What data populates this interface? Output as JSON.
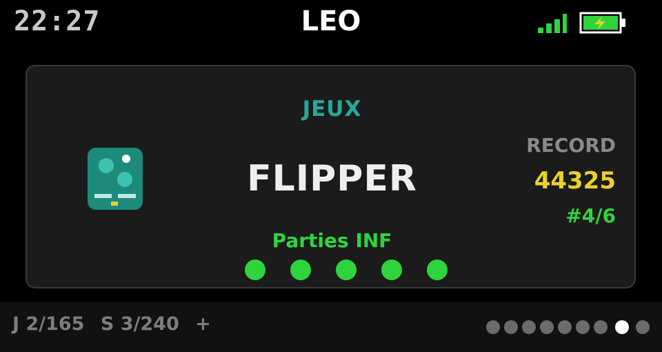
{
  "status_bar": {
    "time": "22:27",
    "device_name": "LEO",
    "signal_icon": "signal-bars-icon",
    "battery_icon": "battery-charging-icon",
    "accent_green": "#2fd43d",
    "battery_fill": "#e9d12d"
  },
  "card": {
    "category": "JEUX",
    "icon": "pinball-game-icon",
    "title": "FLIPPER",
    "plays_label": "Parties INF",
    "plays_dots_count": 5,
    "record": {
      "label": "RECORD",
      "score": "44325",
      "rank": "#4/6"
    }
  },
  "footer": {
    "games_counter": "J 2/165",
    "score_counter": "S 3/240",
    "more_indicator": "+",
    "pager": {
      "total": 9,
      "active_index": 7
    }
  }
}
